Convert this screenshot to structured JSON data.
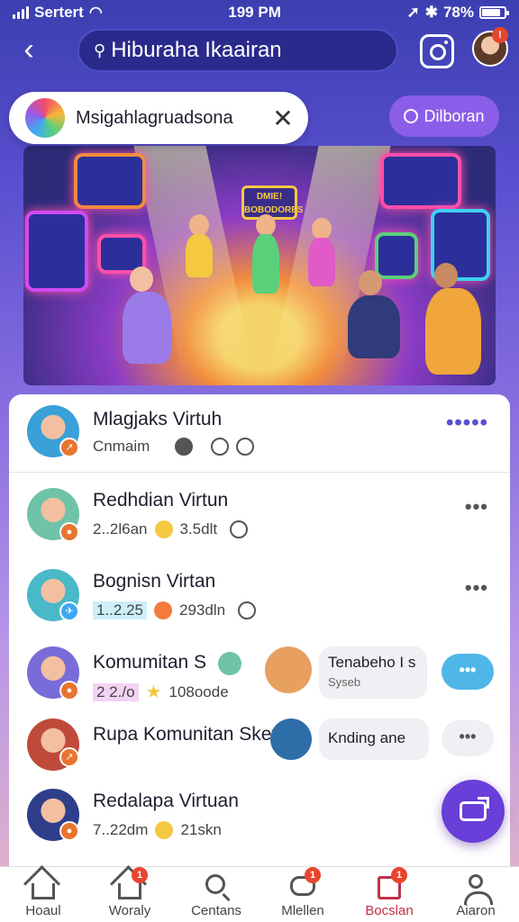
{
  "status_bar": {
    "carrier": "Sertert",
    "time": "199 PM",
    "battery": "78%",
    "battery_level": 0.78
  },
  "header": {
    "search": {
      "value": "Hiburaha Ikaairan"
    }
  },
  "chip": {
    "text": "Msigahlagruadsona"
  },
  "action_pill": {
    "label": "Dilboran"
  },
  "banner": {
    "sign_text": "DMIE! BOBODORES"
  },
  "list": [
    {
      "title": "Mlagjaks Virtuh",
      "meta": "Cnmaim",
      "more": "•••••",
      "avatar_color": "#3aa0d8"
    },
    {
      "title": "Redhdian Virtun",
      "meta1": "2..2l6an",
      "meta2": "3.5dlt",
      "more": "•••",
      "avatar_color": "#6fc3a8"
    },
    {
      "title": "Bognisn Virtan",
      "meta1": "1..2.25",
      "meta2": "293dln",
      "more": "•••",
      "avatar_color": "#49b8c7"
    },
    {
      "title": "Komumitan S",
      "meta1": "2 2./o",
      "meta2": "108oode",
      "bubble_title": "Tenabeho I s",
      "bubble_sub": "Syseb",
      "dots": "•••",
      "avatar_color": "#7a6cd8"
    },
    {
      "title": "Rupa Komunitan Sket",
      "bubble_title": "Knding ane",
      "dots": "•••",
      "avatar_color": "#c04a3a"
    },
    {
      "title": "Redalapa Virtuan",
      "meta1": "7..22dm",
      "meta2": "21skn",
      "avatar_color": "#2e3e8a"
    }
  ],
  "bottom_nav": [
    {
      "label": "Hoaul",
      "icon": "home-icon"
    },
    {
      "label": "Woraly",
      "icon": "house-icon",
      "badge": "1"
    },
    {
      "label": "Centans",
      "icon": "search-icon"
    },
    {
      "label": "Mlellen",
      "icon": "chat-icon",
      "badge": "1"
    },
    {
      "label": "Bocslan",
      "icon": "book-icon",
      "badge": "1",
      "active": true
    },
    {
      "label": "Aiaron",
      "icon": "person-icon"
    }
  ],
  "colors": {
    "accent": "#6a3ed8",
    "pill": "#8a5ee8",
    "badge": "#e8452e",
    "active_nav": "#c0304a"
  }
}
